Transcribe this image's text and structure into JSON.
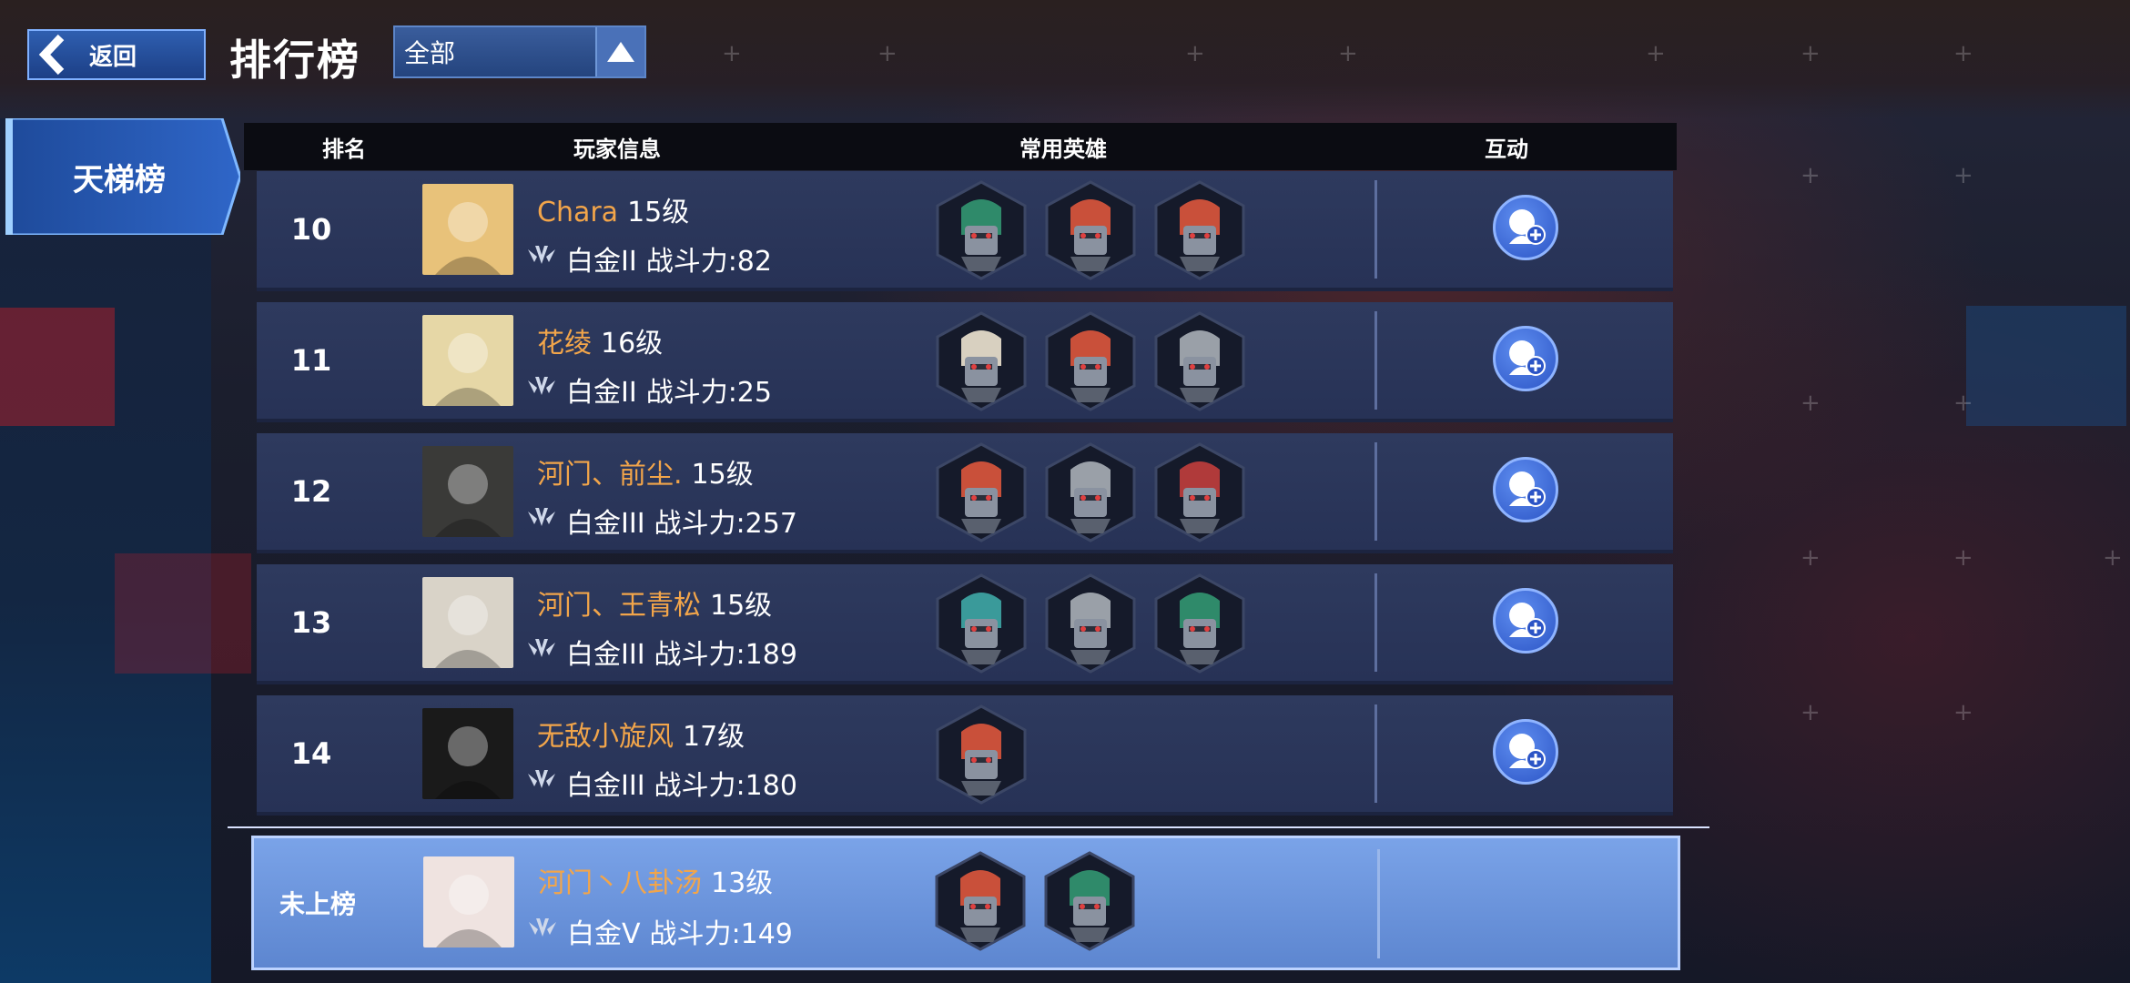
{
  "header": {
    "back_label": "返回",
    "title": "排行榜",
    "filter_value": "全部"
  },
  "tabs": [
    {
      "label": "天梯榜",
      "active": true
    }
  ],
  "table": {
    "columns": [
      "排名",
      "玩家信息",
      "常用英雄",
      "互动"
    ]
  },
  "rows": [
    {
      "rank": "10",
      "name": "Chara",
      "level": "15级",
      "tier": "白金II",
      "power_label": "战斗力:82",
      "avatar_color": "#e8c27a",
      "heroes": [
        "#2f8a6a",
        "#c9503a",
        "#c9503a"
      ]
    },
    {
      "rank": "11",
      "name": "花绫",
      "level": "16级",
      "tier": "白金II",
      "power_label": "战斗力:25",
      "avatar_color": "#e6d7a6",
      "heroes": [
        "#d8d0c0",
        "#c9503a",
        "#9aa0a8"
      ]
    },
    {
      "rank": "12",
      "name": "河门、前尘.",
      "level": "15级",
      "tier": "白金III",
      "power_label": "战斗力:257",
      "avatar_color": "#3a3a38",
      "heroes": [
        "#c9503a",
        "#9aa0a8",
        "#b03a3a"
      ]
    },
    {
      "rank": "13",
      "name": "河门、王青松",
      "level": "15级",
      "tier": "白金III",
      "power_label": "战斗力:189",
      "avatar_color": "#d9d3c8",
      "heroes": [
        "#3a9a9a",
        "#9aa0a8",
        "#2f8a6a"
      ]
    },
    {
      "rank": "14",
      "name": "无敌小旋风",
      "level": "17级",
      "tier": "白金III",
      "power_label": "战斗力:180",
      "avatar_color": "#1a1a1a",
      "heroes": [
        "#c9503a"
      ]
    }
  ],
  "my_row": {
    "rank": "未上榜",
    "name": "河门丶八卦汤",
    "level": "13级",
    "tier": "白金V",
    "power_label": "战斗力:149",
    "avatar_color": "#efe3e0",
    "heroes": [
      "#c9503a",
      "#2f8a6a"
    ]
  },
  "colors": {
    "accent": "#f2a54a",
    "row_bg": "#2e3a5e",
    "my_row_bg": "#7aa3e8",
    "button_blue": "#3b67d6"
  }
}
